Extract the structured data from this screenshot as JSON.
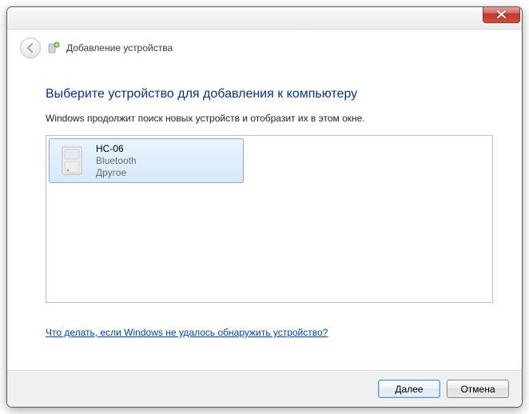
{
  "window": {
    "title": "Добавление устройства"
  },
  "main": {
    "heading": "Выберите устройство для добавления к компьютеру",
    "subtext": "Windows продолжит поиск новых устройств и отобразит их в этом окне."
  },
  "devices": [
    {
      "name": "HC-06",
      "type": "Bluetooth",
      "category": "Другое"
    }
  ],
  "help_link": "Что делать, если Windows не удалось обнаружить устройство?",
  "footer": {
    "next": "Далее",
    "cancel": "Отмена"
  }
}
